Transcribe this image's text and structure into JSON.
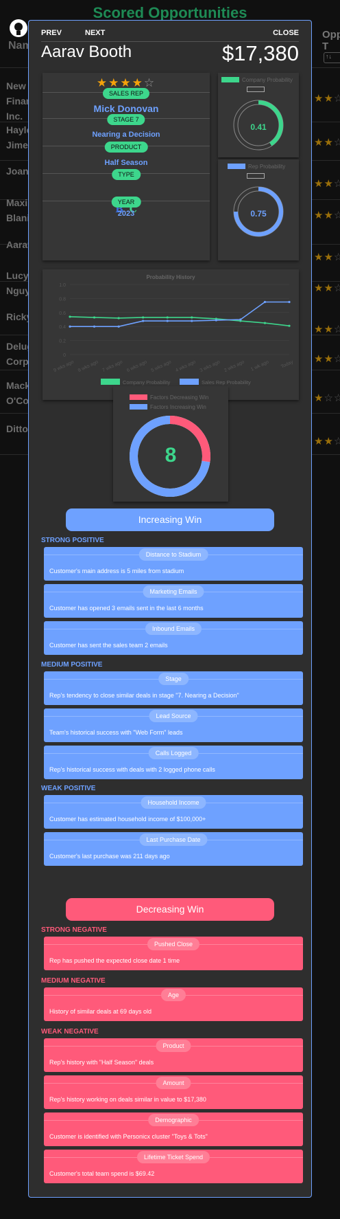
{
  "background": {
    "title": "Scored Opportunities",
    "column_name": "Name",
    "column_opp": "Opp T",
    "sort_control": "↑↓",
    "rows": [
      {
        "name": "New Finan Inc.",
        "stars": 2
      },
      {
        "name": "Hayle Jimen",
        "stars": 2
      },
      {
        "name": "Joan",
        "stars": 2
      },
      {
        "name": "Maxi Blani",
        "stars": 2
      },
      {
        "name": "Aarav",
        "stars": 2
      },
      {
        "name": "Lucy Nguy",
        "stars": 2
      },
      {
        "name": "Ricky",
        "stars": 2
      },
      {
        "name": "Delug Corp",
        "stars": 2
      },
      {
        "name": "Mack O'Co",
        "stars": 1
      },
      {
        "name": "Ditto",
        "stars": 2
      }
    ]
  },
  "modal": {
    "prev_label": "PREV",
    "next_label": "NEXT",
    "close_label": "CLOSE",
    "customer_name": "Aarav Booth",
    "amount": "$17,380",
    "rating": 4,
    "rating_max": 5,
    "info": {
      "sales_rep_label": "SALES REP",
      "sales_rep": "Mick Donovan",
      "stage_label": "STAGE 7",
      "stage": "Nearing a Decision",
      "product_label": "PRODUCT",
      "product": "Half Season",
      "type_label": "TYPE",
      "type_b": "B",
      "type_c": "C",
      "year_label": "YEAR",
      "year": "2023"
    },
    "company_probability": {
      "label": "Company Probability",
      "value": 0.41,
      "display": "0.41",
      "color": "#3dd68c"
    },
    "rep_probability": {
      "label": "Rep Probability",
      "value": 0.75,
      "display": "0.75",
      "color": "#6ea1ff"
    },
    "factors": {
      "decreasing_label": "Factors Decreasing Win",
      "increasing_label": "Factors Increasing Win",
      "count": "8",
      "decreasing_count": 3,
      "increasing_count": 8
    },
    "increasing_title": "Increasing Win",
    "decreasing_title": "Decreasing Win",
    "increasing_groups": [
      {
        "title": "STRONG POSITIVE",
        "items": [
          {
            "tag": "Distance to Stadium",
            "desc": "Customer's main address is 5 miles from stadium"
          },
          {
            "tag": "Marketing Emails",
            "desc": "Customer has opened 3 emails sent in the last 6 months"
          },
          {
            "tag": "Inbound Emails",
            "desc": "Customer has sent the sales team 2 emails"
          }
        ]
      },
      {
        "title": "MEDIUM POSITIVE",
        "items": [
          {
            "tag": "Stage",
            "desc": "Rep's tendency to close similar deals in stage \"7. Nearing a Decision\""
          },
          {
            "tag": "Lead Source",
            "desc": "Team's historical success with \"Web Form\" leads"
          },
          {
            "tag": "Calls Logged",
            "desc": "Rep's historical success with deals with 2 logged phone calls"
          }
        ]
      },
      {
        "title": "WEAK POSITIVE",
        "items": [
          {
            "tag": "Household Income",
            "desc": "Customer has estimated household income of $100,000+"
          },
          {
            "tag": "Last Purchase Date",
            "desc": "Customer's last purchase was 211 days ago"
          }
        ]
      }
    ],
    "decreasing_groups": [
      {
        "title": "STRONG NEGATIVE",
        "items": [
          {
            "tag": "Pushed Close",
            "desc": "Rep has pushed the expected close date 1 time"
          }
        ]
      },
      {
        "title": "MEDIUM NEGATIVE",
        "items": [
          {
            "tag": "Age",
            "desc": "History of similar deals at 69 days old"
          }
        ]
      },
      {
        "title": "WEAK NEGATIVE",
        "items": [
          {
            "tag": "Product",
            "desc": "Rep's history with \"Half Season\" deals"
          },
          {
            "tag": "Amount",
            "desc": "Rep's history working on deals similar in value to $17,380"
          },
          {
            "tag": "Demographic",
            "desc": "Customer is identified with Personicx cluster \"Toys & Tots\""
          },
          {
            "tag": "Lifetime Ticket Spend",
            "desc": "Customer's total team spend is $69.42"
          }
        ]
      }
    ]
  },
  "chart_data": {
    "type": "line",
    "title": "Probability History",
    "categories": [
      "9 wks ago",
      "8 wks ago",
      "7 wks ago",
      "6 wks ago",
      "5 wks ago",
      "4 wks ago",
      "3 wks ago",
      "2 wks ago",
      "1 wk ago",
      "Today"
    ],
    "series": [
      {
        "name": "Company Probability",
        "color": "#3dd68c",
        "values": [
          0.54,
          0.53,
          0.52,
          0.53,
          0.53,
          0.53,
          0.51,
          0.48,
          0.45,
          0.41
        ]
      },
      {
        "name": "Sales Rep Probability",
        "color": "#6ea1ff",
        "values": [
          0.4,
          0.4,
          0.4,
          0.48,
          0.48,
          0.48,
          0.49,
          0.5,
          0.75,
          0.75
        ]
      }
    ],
    "ylim": [
      0,
      1
    ],
    "yticks": [
      "0",
      "0.2",
      "0.4",
      "0.6",
      "0.8",
      "1.0"
    ],
    "grid": true,
    "legend": "bottom"
  }
}
